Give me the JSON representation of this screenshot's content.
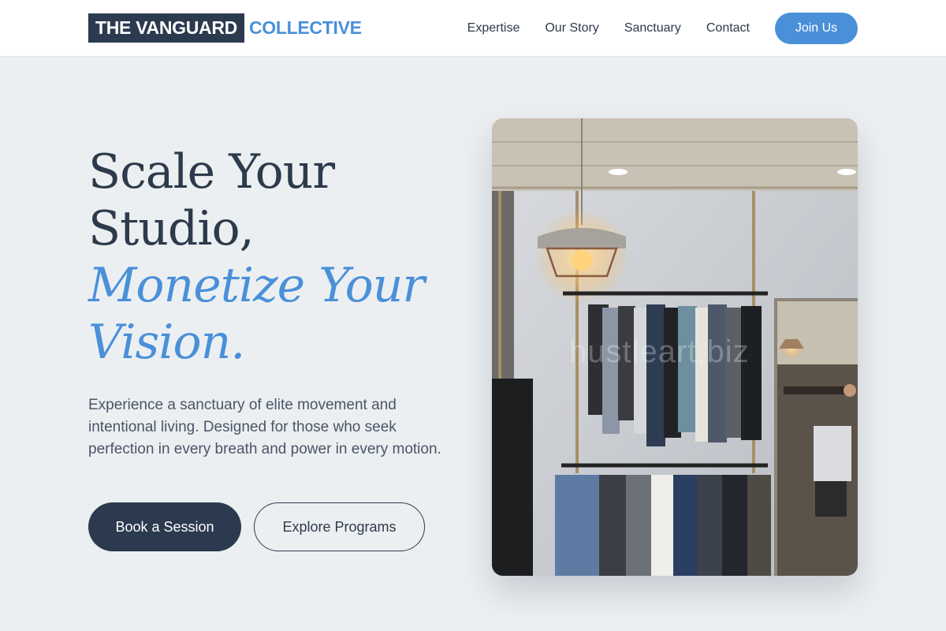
{
  "header": {
    "logo_dark": "THE VANGUARD",
    "logo_light": "COLLECTIVE",
    "nav": [
      "Expertise",
      "Our Story",
      "Sanctuary",
      "Contact"
    ],
    "cta": "Join Us"
  },
  "hero": {
    "headline_line1": "Scale Your",
    "headline_line2": "Studio,",
    "accent_line1": "Monetize Your",
    "accent_line2": "Vision.",
    "intro": "Experience a sanctuary of elite movement and intentional living. Designed for those who seek perfection in every breath and power in every motion.",
    "primary_button": "Book a Session",
    "secondary_button": "Explore Programs",
    "image_watermark": "hustleart.biz"
  },
  "colors": {
    "brand_dark": "#2B3A4E",
    "accent": "#4A90D9",
    "background": "#ECEFF1"
  }
}
